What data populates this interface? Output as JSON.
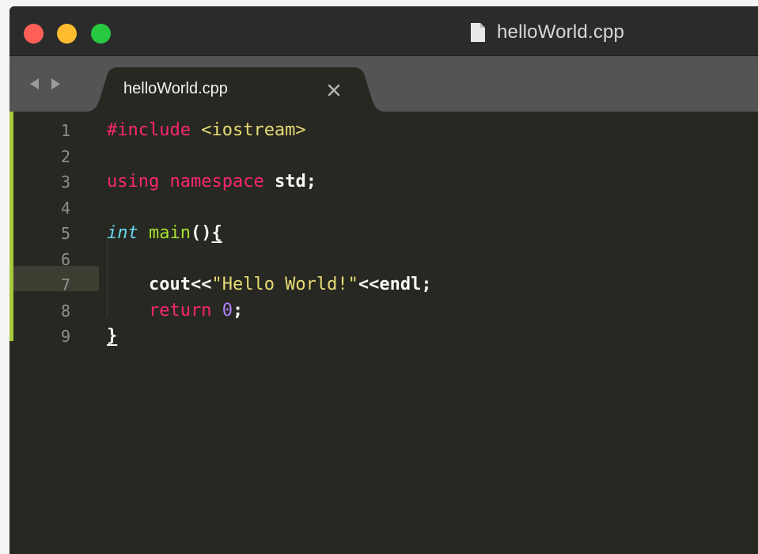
{
  "window": {
    "title": "helloWorld.cpp",
    "controls": [
      "close",
      "minimize",
      "maximize"
    ]
  },
  "tabs": [
    {
      "label": "helloWorld.cpp",
      "close_glyph": "×",
      "active": true
    }
  ],
  "icons": {
    "title": "file-icon",
    "nav_back": "triangle-left-icon",
    "nav_forward": "triangle-right-icon",
    "tab_close": "close-icon"
  },
  "colors": {
    "editor_bg": "#272822",
    "titlebar_bg": "#2b2b2b",
    "tabbar_bg": "#545454",
    "modified_marker": "#a6c93b",
    "keyword": "#f92672",
    "string": "#e6db74",
    "type": "#66d9ef",
    "function": "#a6e22e",
    "number": "#ae81ff"
  },
  "editor": {
    "current_line": 7,
    "line_numbers": [
      "1",
      "2",
      "3",
      "4",
      "5",
      "6",
      "7",
      "8",
      "9"
    ],
    "lines": [
      [
        {
          "t": "#include",
          "c": "kw-pink"
        },
        {
          "t": " ",
          "c": "plain"
        },
        {
          "t": "<iostream>",
          "c": "str"
        }
      ],
      [],
      [
        {
          "t": "using",
          "c": "kw-pink"
        },
        {
          "t": " ",
          "c": "plain"
        },
        {
          "t": "namespace",
          "c": "kw-pink"
        },
        {
          "t": " ",
          "c": "plain"
        },
        {
          "t": "std;",
          "c": "plain"
        }
      ],
      [],
      [
        {
          "t": "int",
          "c": "type"
        },
        {
          "t": " ",
          "c": "plain"
        },
        {
          "t": "main",
          "c": "fn"
        },
        {
          "t": "()",
          "c": "plain"
        },
        {
          "t": "{",
          "c": "bracket"
        }
      ],
      [],
      [
        {
          "t": "    ",
          "c": "plain"
        },
        {
          "t": "cout<<",
          "c": "plain"
        },
        {
          "t": "\"Hello World!\"",
          "c": "str"
        },
        {
          "t": "<<endl;",
          "c": "plain"
        }
      ],
      [
        {
          "t": "    ",
          "c": "plain"
        },
        {
          "t": "return",
          "c": "kw-pink"
        },
        {
          "t": " ",
          "c": "plain"
        },
        {
          "t": "0",
          "c": "num"
        },
        {
          "t": ";",
          "c": "plain"
        }
      ],
      [
        {
          "t": "}",
          "c": "bracket"
        }
      ]
    ]
  }
}
